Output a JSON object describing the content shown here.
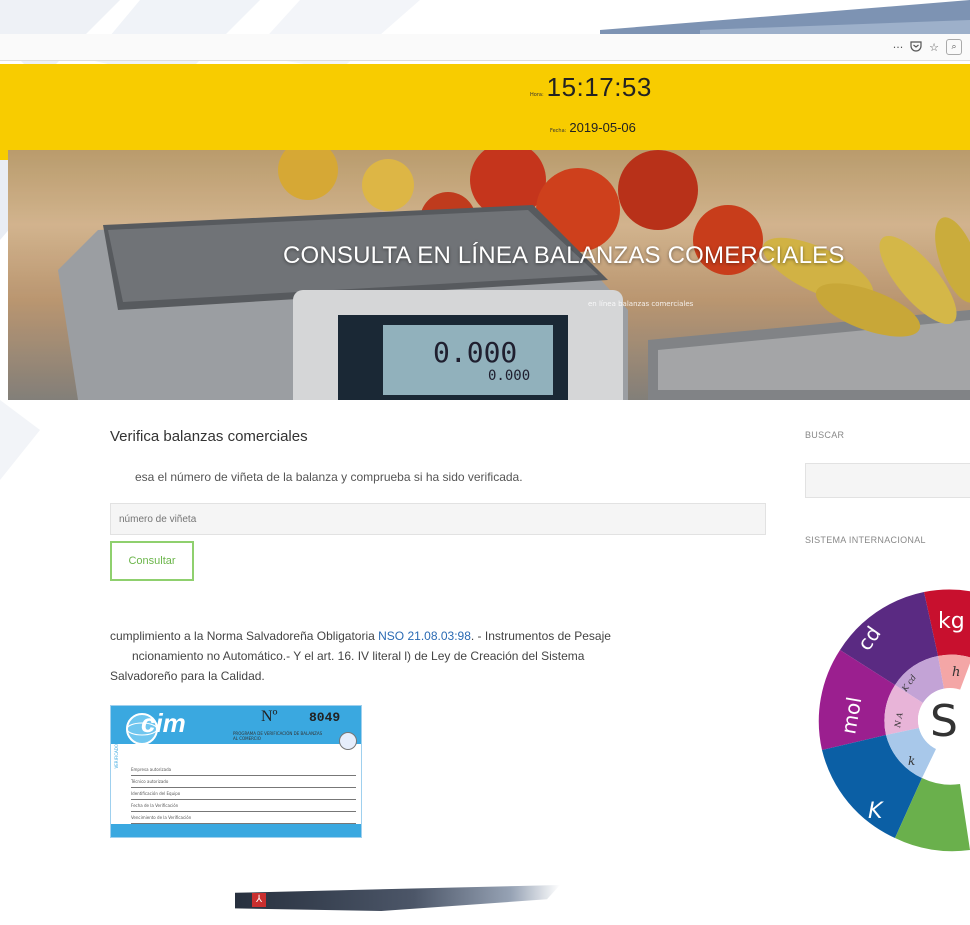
{
  "header": {
    "time_label": "Hora:",
    "time": "15:17:53",
    "date_label": "Fecha:",
    "date": "2019-05-06"
  },
  "browser": {
    "icons": [
      "more-icon",
      "pocket-icon",
      "star-icon",
      "search-icon"
    ]
  },
  "hero": {
    "title": "CONSULTA EN LÍNEA BALANZAS COMERCIALES",
    "breadcrumb": "en línea balanzas comerciales"
  },
  "main": {
    "title": "Verifica balanzas comerciales",
    "instruction": "esa el número de viñeta de la balanza y comprueba si ha sido verificada.",
    "input_placeholder": "número de viñeta",
    "button_label": "Consultar",
    "norma_prefix": "cumplimiento a la Norma Salvadoreña Obligatoria ",
    "norma_link": "NSO 21.08.03:98",
    "norma_line1_rest": ". - Instrumentos de Pesaje",
    "norma_line2": "ncionamiento no Automático.- Y el art. 16. IV literal l) de Ley de Creación del Sistema",
    "norma_line3": "Salvadoreño para la Calidad."
  },
  "sticker": {
    "logo": "cim",
    "number_label": "Nº",
    "number": "8049",
    "program": "PROGRAMA DE VERIFICACIÓN DE BALANZAS AL COMERCIO",
    "side_label": "VERIFICADO",
    "fields": [
      "Empresa autorizada",
      "Técnico autorizado",
      "Identificación del Equipo",
      "Fecha de la Verificación",
      "Vencimiento de la Verificación"
    ]
  },
  "sidebar": {
    "search_title": "BUSCAR",
    "si_title": "SISTEMA INTERNACIONAL"
  },
  "si_wheel": {
    "outer": [
      "kg",
      "cd",
      "mol",
      "K"
    ],
    "inner": [
      "h",
      "K cd",
      "N A",
      "k"
    ],
    "center": "S",
    "colors": {
      "kg": "#c8102e",
      "cd": "#5a2a82",
      "mol": "#9b1f8f",
      "K": "#0b5fa5",
      "green": "#6ab04c",
      "pink": "#f4a6a6",
      "lavender": "#c3a3d6",
      "light_pink": "#e8b4d8",
      "light_blue": "#a8c8ea"
    }
  },
  "colors": {
    "header_yellow": "#f8cc00",
    "button_green": "#8fd06e",
    "link_blue": "#2a6ab3",
    "sticker_blue": "#3aa8e0"
  }
}
